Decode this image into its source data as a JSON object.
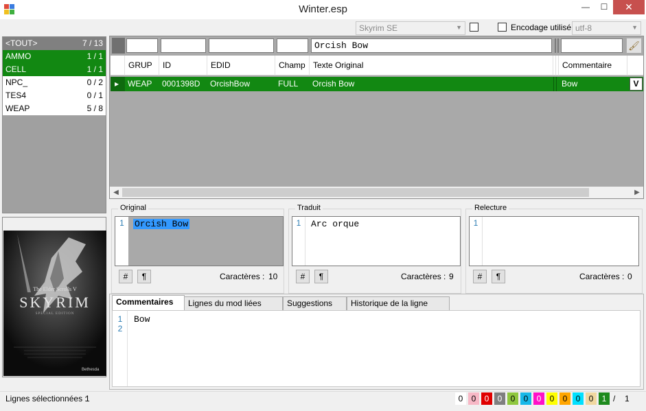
{
  "window": {
    "title": "Winter.esp",
    "minimize": "—",
    "maximize": "☐",
    "close": "✕"
  },
  "options": {
    "game": "Skyrim SE",
    "encoding_label": "Encodage utilisé",
    "encoding": "utf-8"
  },
  "left_list": {
    "items": [
      {
        "label": "<TOUT>",
        "count": "7 / 13"
      },
      {
        "label": "AMMO",
        "count": "1 / 1"
      },
      {
        "label": "CELL",
        "count": "1 / 1"
      },
      {
        "label": "NPC_",
        "count": "0 / 2"
      },
      {
        "label": "TES4",
        "count": "0 / 1"
      },
      {
        "label": "WEAP",
        "count": "5 / 8"
      }
    ]
  },
  "cover": {
    "line1": "The Elder Scrolls V",
    "line2": "SKYRIM",
    "line3": "SPECIAL EDITION",
    "publisher": "Bethesda"
  },
  "grid": {
    "filter_text": "Orcish Bow",
    "columns": [
      "GRUP",
      "ID",
      "EDID",
      "Champ",
      "Texte Original",
      "Commentaire"
    ],
    "rows": [
      {
        "grup": "WEAP",
        "id": "0001398D",
        "edid": "OrcishBow",
        "champ": "FULL",
        "texte": "Orcish Bow",
        "commentaire": "Bow",
        "flag": "V"
      }
    ]
  },
  "original": {
    "legend": "Original",
    "line_no": "1",
    "text": "Orcish Bow",
    "chars_label": "Caractères :",
    "chars": "10"
  },
  "traduit": {
    "legend": "Traduit",
    "line_no": "1",
    "text": "Arc orque",
    "chars_label": "Caractères :",
    "chars": "9"
  },
  "relecture": {
    "legend": "Relecture",
    "line_no": "1",
    "text": "",
    "chars_label": "Caractères :",
    "chars": "0"
  },
  "buttons": {
    "hash": "#",
    "pilcrow": "¶"
  },
  "tabs": [
    "Commentaires",
    "Lignes du mod liées",
    "Suggestions",
    "Historique de la ligne"
  ],
  "comments": {
    "line1_no": "1",
    "line2_no": "2",
    "text": "Bow"
  },
  "status": {
    "label": "Lignes sélectionnées :",
    "value": "1",
    "counters": [
      {
        "value": "0",
        "color": "#ffffff"
      },
      {
        "value": "0",
        "color": "#f7b8c6"
      },
      {
        "value": "0",
        "color": "#e00000"
      },
      {
        "value": "0",
        "color": "#7f7f7f"
      },
      {
        "value": "0",
        "color": "#8fc73e"
      },
      {
        "value": "0",
        "color": "#16b8e8"
      },
      {
        "value": "0",
        "color": "#ff10c8"
      },
      {
        "value": "0",
        "color": "#ffff00"
      },
      {
        "value": "0",
        "color": "#ffa500"
      },
      {
        "value": "0",
        "color": "#00e0ff"
      },
      {
        "value": "0",
        "color": "#f0d8a0"
      },
      {
        "value": "1",
        "color": "#1e8a1e"
      }
    ],
    "sep": "/",
    "total": "1"
  },
  "colors": {
    "selected_green": "#128812",
    "grid_bg": "#a9a9a9",
    "list_bg": "#a0a0a0"
  }
}
